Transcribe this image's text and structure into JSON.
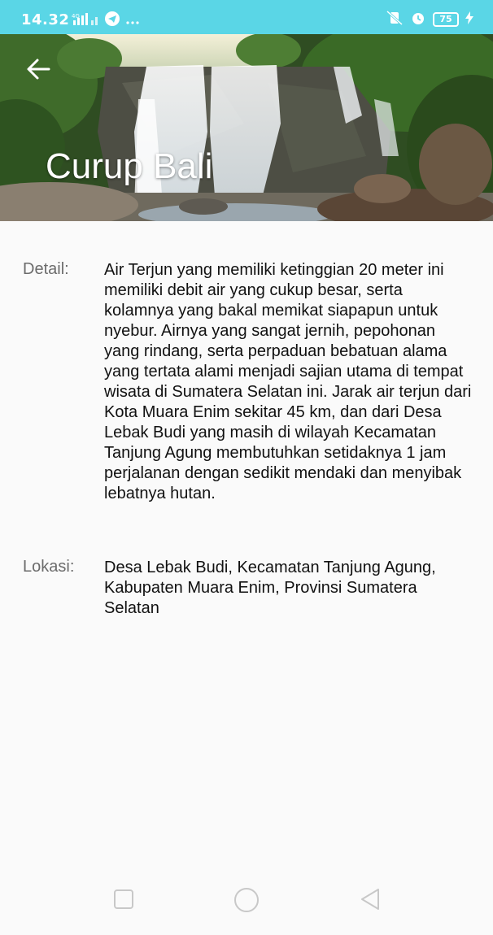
{
  "status_bar": {
    "time": "14.32",
    "network": "4G",
    "battery": "75",
    "icons": [
      "signal-icon",
      "telegram-icon",
      "more-dots-icon",
      "mute-icon",
      "alarm-icon",
      "battery-icon",
      "charging-icon"
    ]
  },
  "header": {
    "title": "Curup Bali",
    "back_icon": "arrow-left-icon"
  },
  "details": {
    "detail_label": "Detail:",
    "detail_text": "Air Terjun yang memiliki ketinggian 20 meter ini memiliki debit air yang cukup besar, serta kolamnya yang bakal memikat siapapun untuk nyebur. Airnya yang sangat jernih, pepohonan yang rindang, serta perpaduan bebatuan alama yang tertata alami menjadi sajian utama di tempat wisata di Sumatera Selatan ini. Jarak air terjun dari Kota Muara Enim sekitar 45 km, dan dari Desa Lebak Budi yang masih di wilayah Kecamatan Tanjung Agung membutuhkan setidaknya 1 jam perjalanan dengan sedikit mendaki dan menyibak lebatnya hutan.",
    "location_label": "Lokasi:",
    "location_text": "Desa Lebak Budi, Kecamatan Tanjung Agung, Kabupaten Muara Enim, Provinsi Sumatera Selatan"
  },
  "nav_bar": {
    "buttons": [
      "recent-apps-icon",
      "home-icon",
      "back-triangle-icon"
    ]
  },
  "colors": {
    "status_bar": "#5ad6e6",
    "background": "#fafafa",
    "label": "#6b6b6b",
    "text": "#111111"
  }
}
